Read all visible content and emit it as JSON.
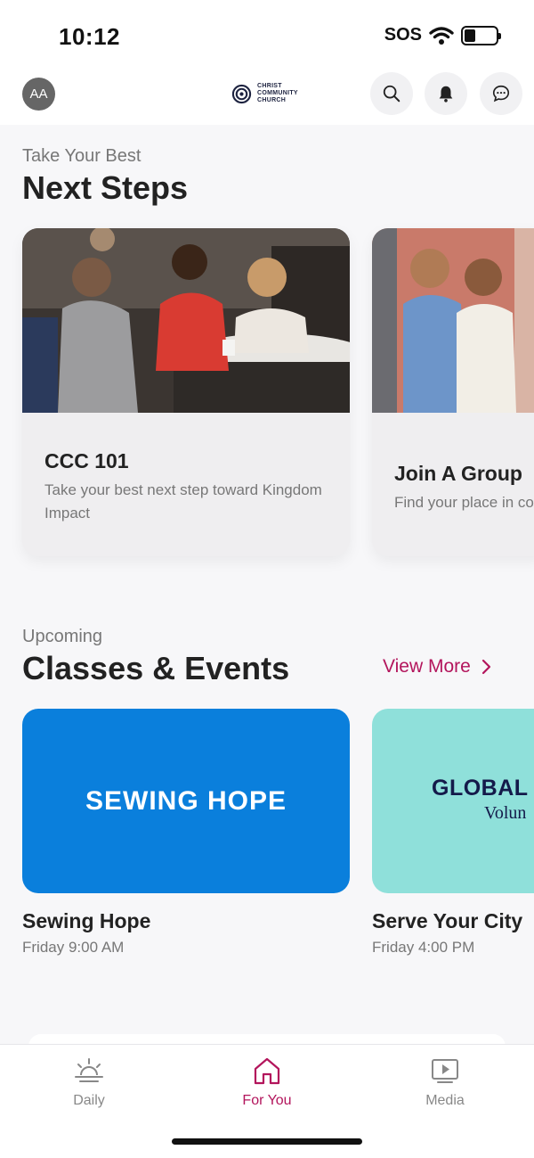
{
  "status_bar": {
    "time": "10:12",
    "carrier": "SOS",
    "battery_level": 0.35
  },
  "header": {
    "avatar_initials": "AA",
    "logo_lines": [
      "CHRIST",
      "COMMUNITY",
      "CHURCH"
    ]
  },
  "next_steps": {
    "eyebrow": "Take Your Best",
    "title": "Next Steps",
    "cards": [
      {
        "title": "CCC 101",
        "description": "Take your best next step toward Kingdom Impact"
      },
      {
        "title": "Join A Group",
        "description": "Find your place in co"
      }
    ]
  },
  "events": {
    "eyebrow": "Upcoming",
    "title": "Classes & Events",
    "view_more": "View More",
    "items": [
      {
        "image_text": "SEWING HOPE",
        "title": "Sewing Hope",
        "time": "Friday 9:00 AM",
        "image_color": "#0a7fdc"
      },
      {
        "image_text": "GLOBAL",
        "image_subtext": "Volun",
        "title": "Serve Your City",
        "time": "Friday 4:00 PM",
        "image_color": "#8fe0da"
      }
    ]
  },
  "tabbar": {
    "tabs": [
      {
        "label": "Daily",
        "icon": "sunrise-icon"
      },
      {
        "label": "For You",
        "icon": "home-icon",
        "active": true
      },
      {
        "label": "Media",
        "icon": "play-icon"
      }
    ]
  },
  "colors": {
    "accent": "#b3155c",
    "background": "#f7f7f9"
  }
}
